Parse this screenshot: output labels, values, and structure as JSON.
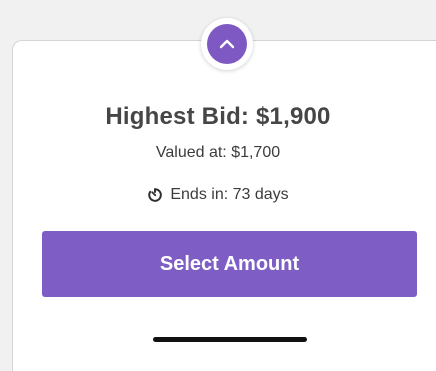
{
  "bid_panel": {
    "highest_bid": "Highest Bid: $1,900",
    "valued_at": "Valued at: $1,700",
    "ends_in": "Ends in: 73 days",
    "select_button_label": "Select Amount"
  },
  "icons": {
    "collapse": "chevron-up-icon",
    "timer": "timer-icon"
  },
  "colors": {
    "accent": "#7e5ec5",
    "text_primary": "#464646",
    "text_secondary": "#3c3c3c"
  }
}
